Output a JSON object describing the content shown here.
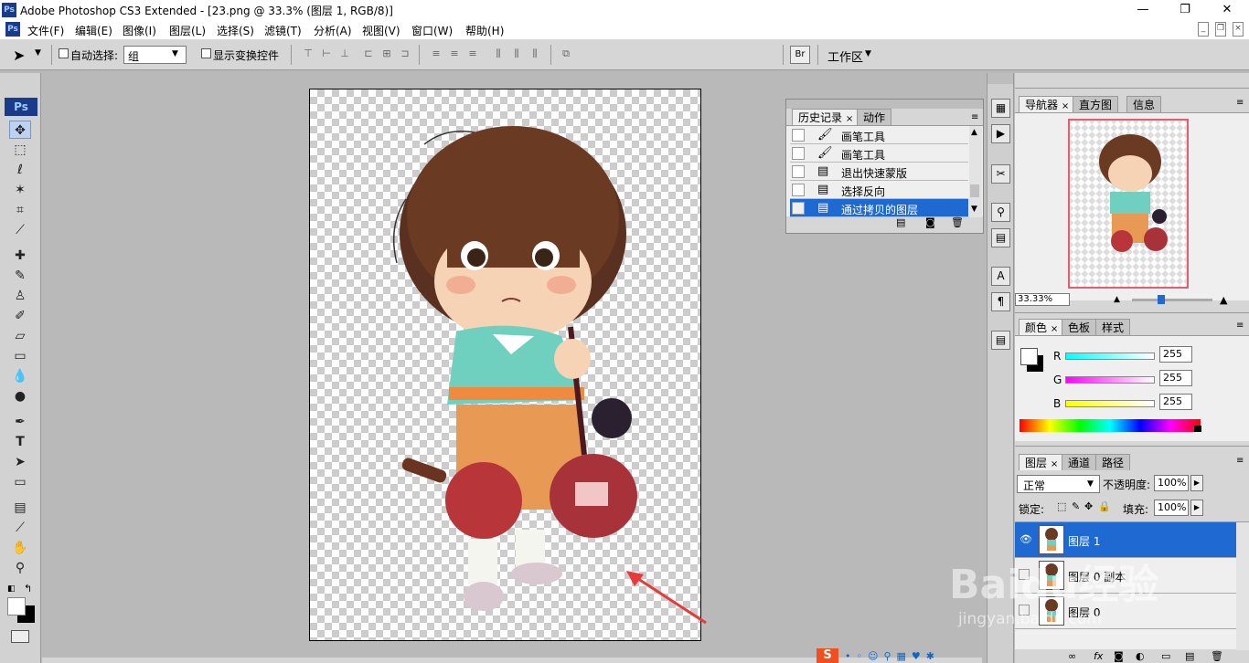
{
  "app": {
    "logo": "Ps",
    "title": "Adobe Photoshop CS3 Extended - [23.png @ 33.3% (图层 1, RGB/8)]"
  },
  "window_controls": {
    "minimize": "—",
    "maximize": "❐",
    "close": "✕"
  },
  "menu": [
    "文件(F)",
    "编辑(E)",
    "图像(I)",
    "图层(L)",
    "选择(S)",
    "滤镜(T)",
    "分析(A)",
    "视图(V)",
    "窗口(W)",
    "帮助(H)"
  ],
  "doc_controls": {
    "minimize": "_",
    "restore": "❐",
    "close": "×"
  },
  "options": {
    "auto_select_label": "自动选择:",
    "auto_select_value": "组",
    "show_transform_label": "显示变换控件",
    "workspace_label": "工作区"
  },
  "toolbox": {
    "logo": "Ps"
  },
  "history_panel": {
    "tabs": [
      "历史记录",
      "动作"
    ],
    "items": [
      {
        "label": "画笔工具",
        "icon": "brush-icon"
      },
      {
        "label": "画笔工具",
        "icon": "brush-icon"
      },
      {
        "label": "退出快速蒙版",
        "icon": "document-icon"
      },
      {
        "label": "选择反向",
        "icon": "document-icon"
      },
      {
        "label": "通过拷贝的图层",
        "icon": "document-icon",
        "selected": true
      }
    ]
  },
  "navigator_panel": {
    "tabs": [
      "导航器",
      "直方图",
      "信息"
    ],
    "zoom": "33.33%"
  },
  "color_panel": {
    "tabs": [
      "颜色",
      "色板",
      "样式"
    ],
    "channels": [
      {
        "label": "R",
        "value": "255"
      },
      {
        "label": "G",
        "value": "255"
      },
      {
        "label": "B",
        "value": "255"
      }
    ]
  },
  "layers_panel": {
    "tabs": [
      "图层",
      "通道",
      "路径"
    ],
    "blend_mode": "正常",
    "opacity_label": "不透明度:",
    "opacity_value": "100%",
    "lock_label": "锁定:",
    "fill_label": "填充:",
    "fill_value": "100%",
    "layers": [
      {
        "name": "图层 1",
        "visible": true,
        "selected": true
      },
      {
        "name": "图层 0 副本",
        "visible": false,
        "selected": false
      },
      {
        "name": "图层 0",
        "visible": false,
        "selected": false
      }
    ]
  },
  "watermark": {
    "text": "Baidu经验",
    "url": "jingyan.baidu.com"
  },
  "colors": {
    "selection": "#1e6ad2",
    "accent_arrow": "#e83a3a"
  }
}
